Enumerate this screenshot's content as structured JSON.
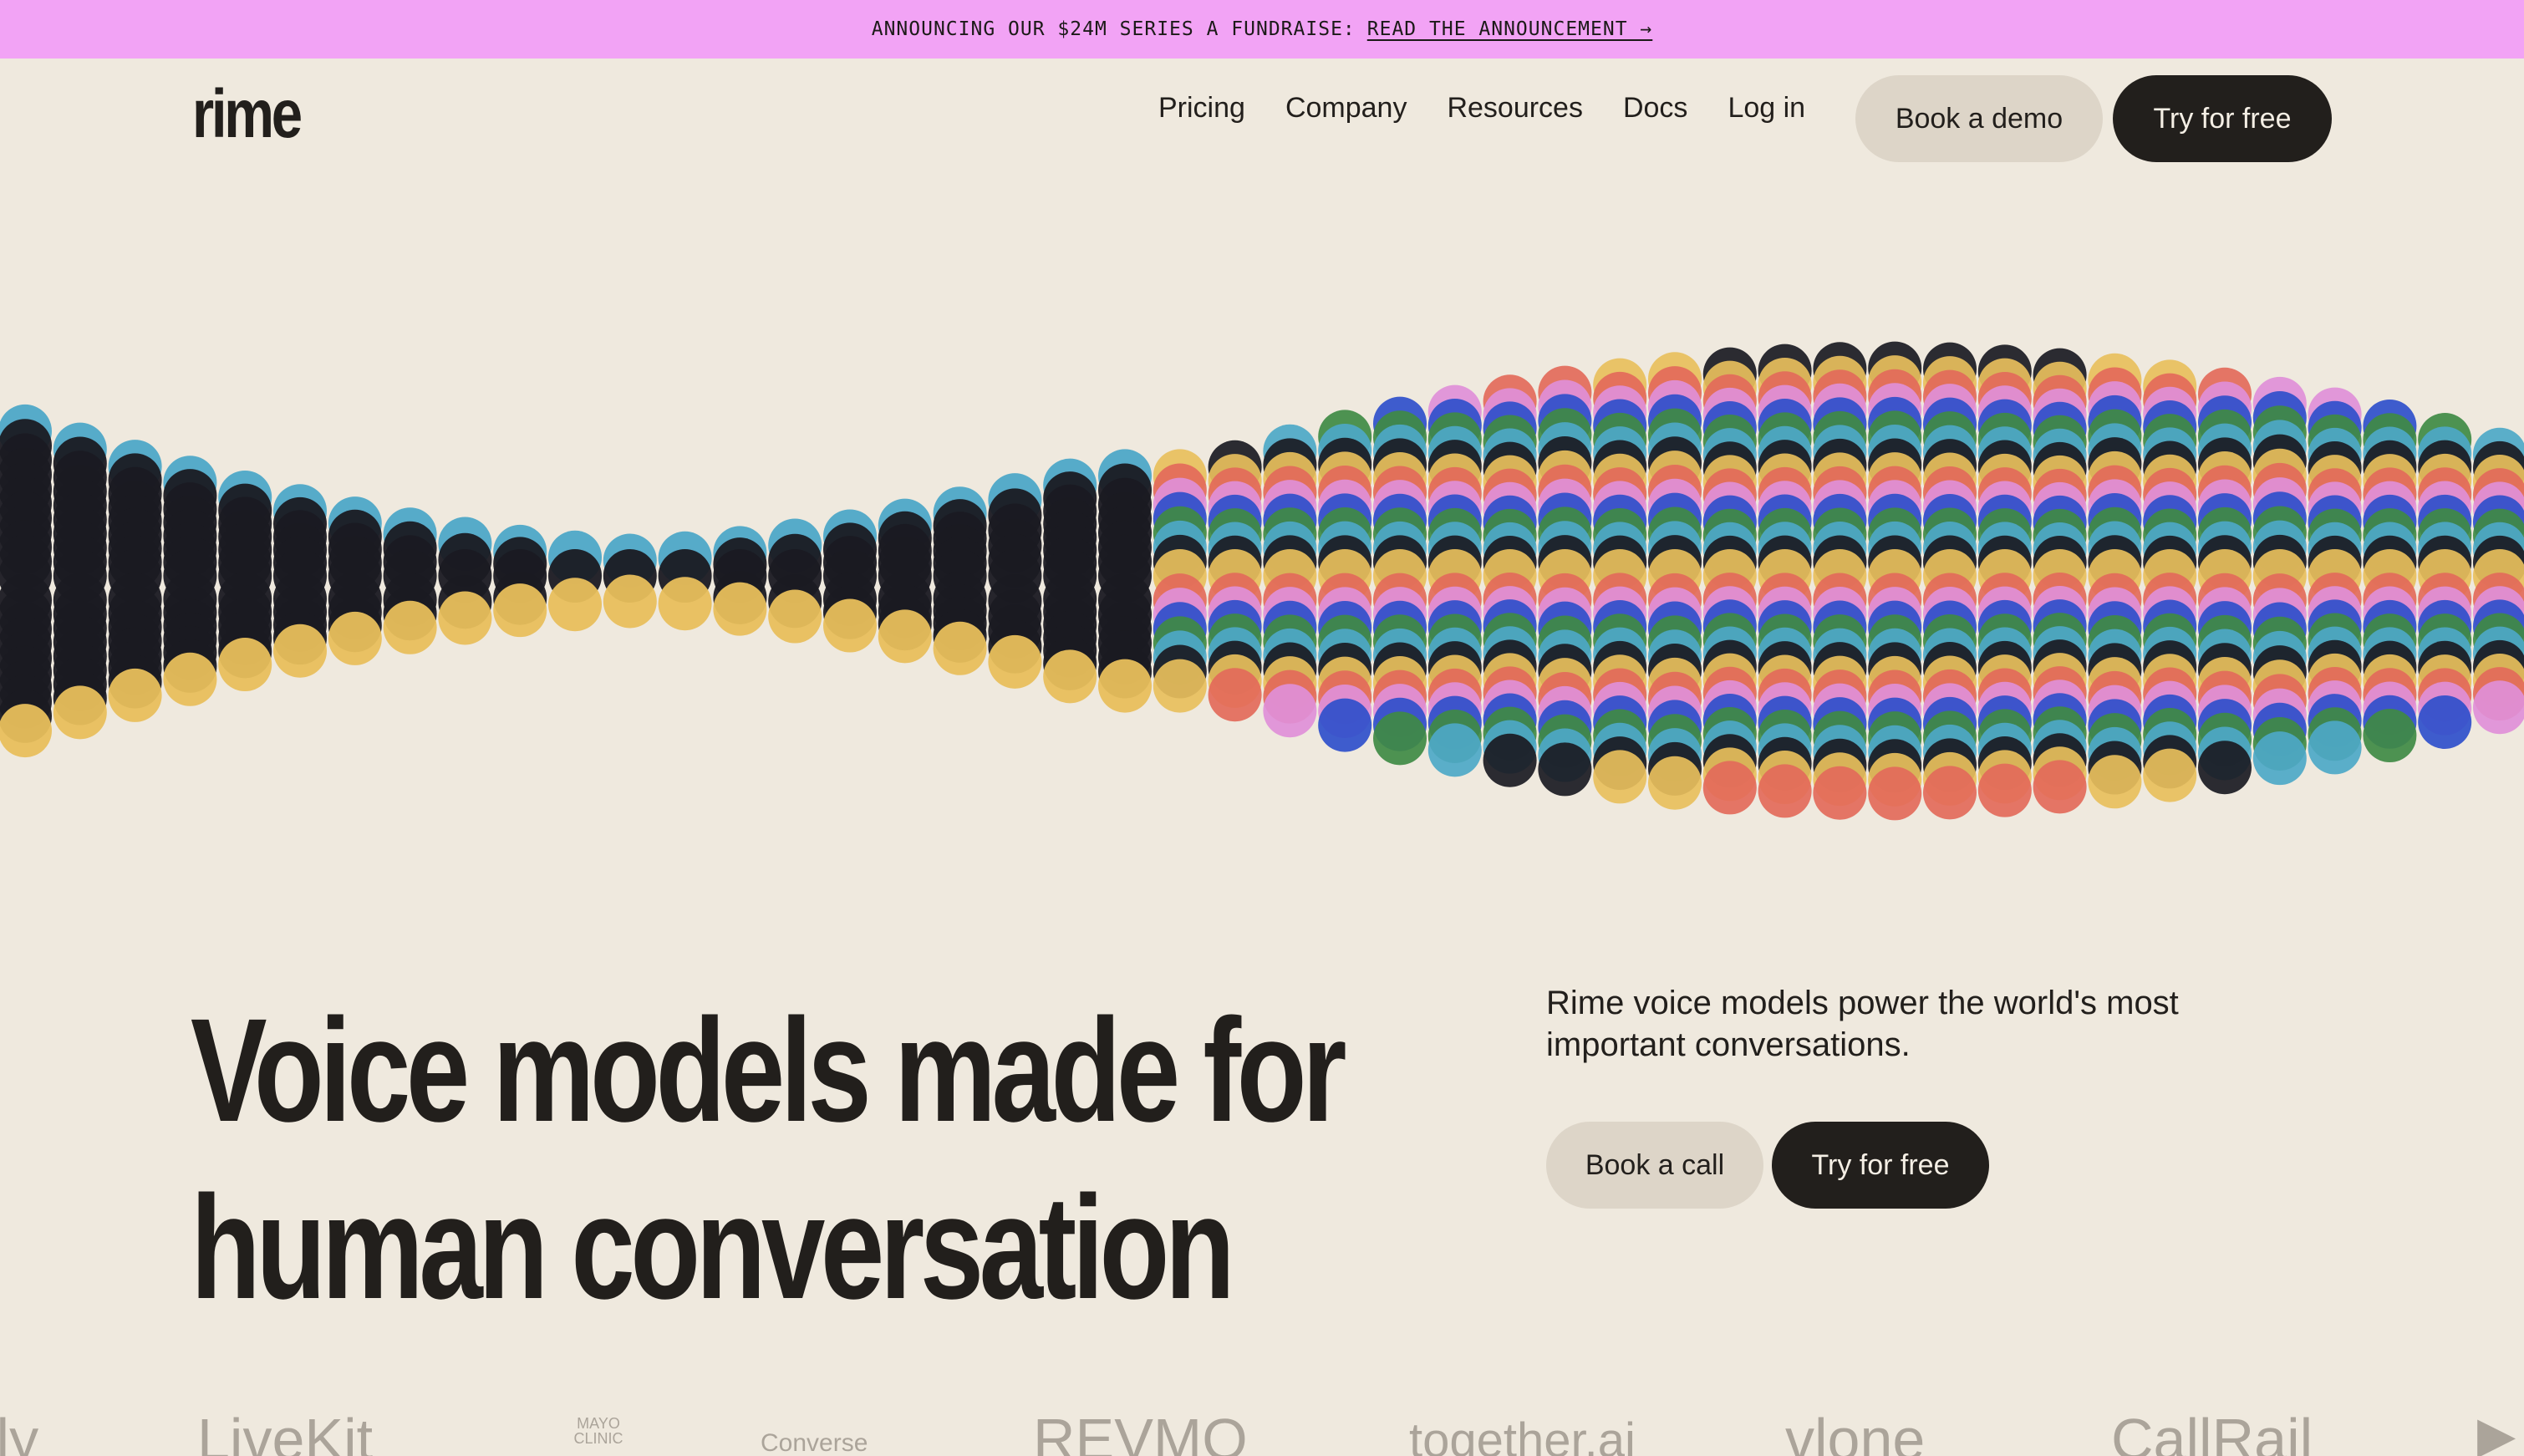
{
  "banner": {
    "text": "ANNOUNCING OUR $24M SERIES A FUNDRAISE:",
    "link": "READ THE ANNOUNCEMENT →"
  },
  "header": {
    "logo": "rime",
    "nav": [
      "Pricing",
      "Company",
      "Resources",
      "Docs",
      "Log in"
    ],
    "demo_button": "Book a demo",
    "try_button": "Try for free"
  },
  "hero": {
    "headline_line1": "Voice models made for",
    "headline_line2": "human conversation",
    "subtitle": "Rime voice models power the world's most important conversations.",
    "call_button": "Book a call",
    "try_button": "Try for free"
  },
  "logos": [
    "ily",
    "LiveKit",
    "MAYO CLINIC",
    "Converse",
    "REVMO",
    "together.ai",
    "vlone",
    "CallRail"
  ],
  "colors": {
    "banner": "#f2a3f5",
    "background": "#efe9de",
    "dark": "#221f1c",
    "light_button": "#ddd5c8",
    "wave_palette": [
      "#e8bf5c",
      "#e36a5a",
      "#df8fd8",
      "#2f4fcb",
      "#3f8a44",
      "#4da8c7",
      "#1a1a22"
    ]
  }
}
